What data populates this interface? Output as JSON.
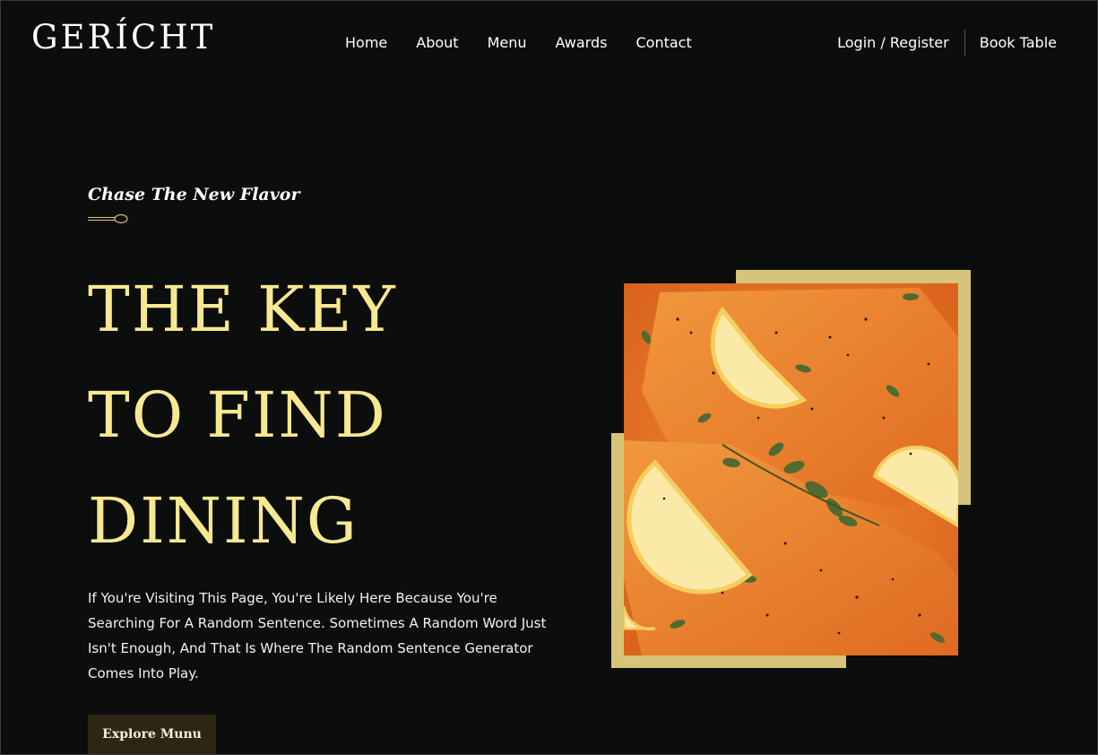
{
  "brand": {
    "logo": "GERÍCHT"
  },
  "nav": {
    "links": [
      {
        "label": "Home"
      },
      {
        "label": "About"
      },
      {
        "label": "Menu"
      },
      {
        "label": "Awards"
      },
      {
        "label": "Contact"
      }
    ],
    "login_label": "Login / Register",
    "book_label": "Book Table"
  },
  "hero": {
    "subtitle": "Chase The New Flavor",
    "headline_lines": [
      "THE KEY",
      "TO FIND",
      "DINING"
    ],
    "description": "If You're Visiting This Page, You're Likely Here Because You're Searching For A Random Sentence. Sometimes A Random Word Just Isn't Enough, And That Is Where The Random Sentence Generator Comes Into Play.",
    "cta_label": "Explore Munu"
  },
  "colors": {
    "background": "#0c0d0d",
    "headline": "#f8e891",
    "accent_gold": "#d5c47a",
    "button_bg": "#2f2514"
  },
  "icons": {
    "spoon": "spoon-icon"
  }
}
